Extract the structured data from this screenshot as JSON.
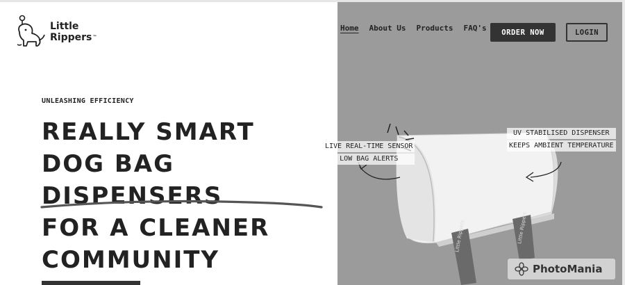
{
  "brand": {
    "name_line1": "Little",
    "name_line2": "Rippers",
    "trademark": "™"
  },
  "nav": {
    "items": [
      {
        "label": "Home",
        "active": true
      },
      {
        "label": "About Us",
        "active": false
      },
      {
        "label": "Products",
        "active": false
      },
      {
        "label": "FAQ's",
        "active": false
      }
    ],
    "order_label": "ORDER NOW",
    "login_label": "LOGIN"
  },
  "hero": {
    "eyebrow": "UNLEASHING EFFICIENCY",
    "headline": [
      "REALLY SMART",
      "DOG BAG",
      "DISPENSERS",
      "FOR A CLEANER",
      "COMMUNITY"
    ]
  },
  "illustration": {
    "callout_left": [
      "LIVE REAL-TIME SENSOR",
      "LOW BAG ALERTS"
    ],
    "callout_right": [
      "UV STABILISED DISPENSER",
      "KEEPS AMBIENT TEMPERATURE"
    ]
  },
  "watermark": {
    "text": "PhotoMania"
  },
  "colors": {
    "panel_gray": "#9b9b9b",
    "button_dark": "#333333",
    "text": "#222222"
  }
}
